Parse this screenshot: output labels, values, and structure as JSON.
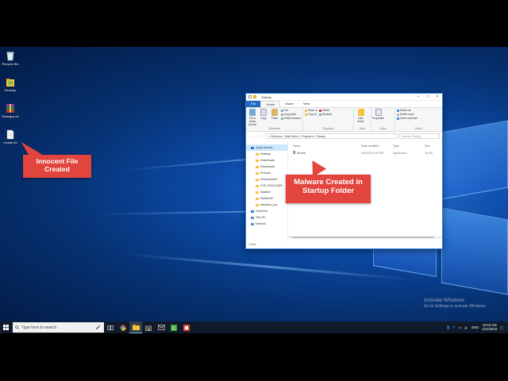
{
  "desktop": {
    "icons": [
      {
        "label": "Recycle Bin",
        "icon": "recycle-bin-icon"
      },
      {
        "label": "Desktop",
        "icon": "folder-icon"
      },
      {
        "label": "Rackapp.rar",
        "icon": "winrar-archive-icon"
      },
      {
        "label": "receipt.txt",
        "icon": "text-file-icon"
      }
    ]
  },
  "callouts": {
    "innocent": "Innocent File Created",
    "malware": "Malware Created in Startup Folder"
  },
  "explorer": {
    "title": "Startup",
    "tabs": [
      "File",
      "Home",
      "Share",
      "View"
    ],
    "ribbon": {
      "clipboard": {
        "pin": "Pin to Quick access",
        "copy": "Copy",
        "paste": "Paste",
        "cut": "Cut",
        "copy_path": "Copy path",
        "paste_shortcut": "Paste shortcut",
        "group": "Clipboard"
      },
      "organize": {
        "move_to": "Move to",
        "copy_to": "Copy to",
        "delete": "Delete",
        "rename": "Rename",
        "group": "Organize"
      },
      "new": {
        "new_folder": "New folder",
        "group": "New"
      },
      "open": {
        "properties": "Properties",
        "group": "Open"
      },
      "select": {
        "select_all": "Select all",
        "select_none": "Select none",
        "invert": "Invert selection",
        "group": "Select"
      }
    },
    "address": "« Windows › Start Menu › Programs › Startup",
    "search_placeholder": "Search Startup",
    "nav": [
      {
        "label": "Quick access",
        "selected": true,
        "sub": false
      },
      {
        "label": "Desktop",
        "selected": false,
        "sub": true
      },
      {
        "label": "Downloads",
        "selected": false,
        "sub": true
      },
      {
        "label": "Documents",
        "selected": false,
        "sub": true
      },
      {
        "label": "Pictures",
        "selected": false,
        "sub": true
      },
      {
        "label": "Development",
        "selected": false,
        "sub": true
      },
      {
        "label": "CVE-2018-12825",
        "selected": false,
        "sub": true
      },
      {
        "label": "injustice",
        "selected": false,
        "sub": true
      },
      {
        "label": "System32",
        "selected": false,
        "sub": true
      },
      {
        "label": "windows_poc",
        "selected": false,
        "sub": true
      },
      {
        "label": "OneDrive",
        "selected": false,
        "sub": false
      },
      {
        "label": "This PC",
        "selected": false,
        "sub": false
      },
      {
        "label": "Network",
        "selected": false,
        "sub": false
      }
    ],
    "columns": [
      "Name",
      "Date modified",
      "Type",
      "Size"
    ],
    "files": [
      {
        "name": "lnt.exe",
        "date": "2/6/2019 5:40 PM",
        "type": "Application",
        "size": "78 KB"
      }
    ],
    "status": "1 item"
  },
  "watermark": {
    "line1": "Activate Windows",
    "line2": "Go to Settings to activate Windows."
  },
  "taskbar": {
    "search_placeholder": "Type here to search",
    "lang": "ENG",
    "time": "10:10 AM",
    "date": "2/12/2019"
  },
  "colors": {
    "callout": "#e2453e",
    "accent": "#1f6bc4",
    "taskbar": "#101a2b"
  }
}
